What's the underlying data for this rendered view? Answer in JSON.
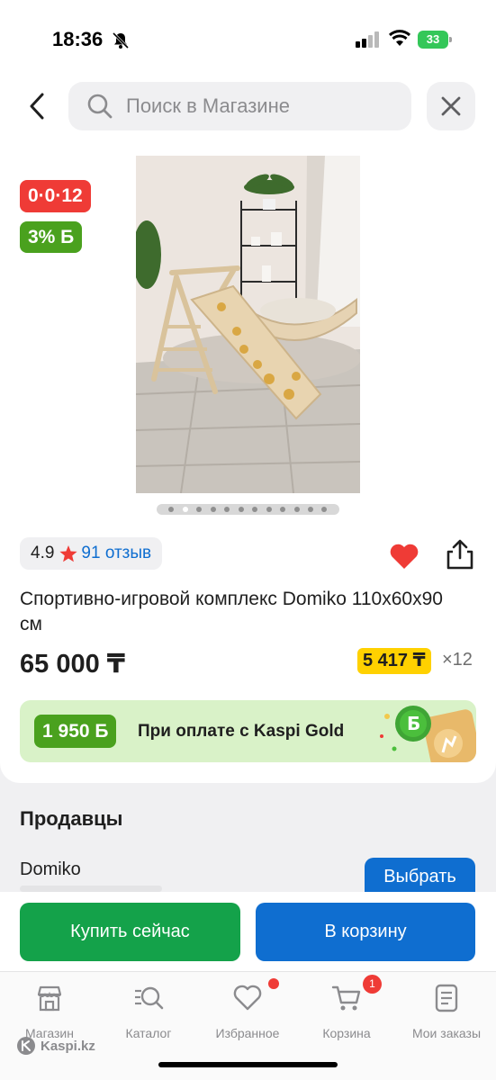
{
  "status_bar": {
    "time": "18:36",
    "battery": "33"
  },
  "header": {
    "search_placeholder": "Поиск в Магазине"
  },
  "badges": {
    "installment": "0·0·12",
    "bonus": "3% Б"
  },
  "gallery": {
    "total_images": 12,
    "current_index": 2
  },
  "product": {
    "rating": "4.9",
    "reviews": "91 отзыв",
    "title": "Спортивно-игровой комплекс Domiko 110x60x90 см",
    "price": "65 000 ₸",
    "monthly_payment": "5 417 ₸",
    "months": "×12"
  },
  "kaspi_gold": {
    "amount": "1 950 Б",
    "text": "При оплате с Kaspi Gold"
  },
  "sellers": {
    "title": "Продавцы",
    "items": [
      {
        "name": "Domiko",
        "button": "Выбрать"
      }
    ]
  },
  "actions": {
    "buy_now": "Купить сейчас",
    "add_to_cart": "В корзину"
  },
  "tabs": [
    {
      "label": "Магазин",
      "icon": "store-icon"
    },
    {
      "label": "Каталог",
      "icon": "catalog-search-icon"
    },
    {
      "label": "Избранное",
      "icon": "heart-icon"
    },
    {
      "label": "Корзина",
      "icon": "cart-icon"
    },
    {
      "label": "Мои заказы",
      "icon": "orders-icon"
    }
  ],
  "cart_badge": "1",
  "watermark": "Kaspi.kz",
  "colors": {
    "red": "#ef3b36",
    "green": "#4aa11e",
    "blue": "#0f6ed0",
    "buy_green": "#14a24a",
    "yellow": "#ffd100",
    "gold_bg": "#d9f2c8"
  }
}
